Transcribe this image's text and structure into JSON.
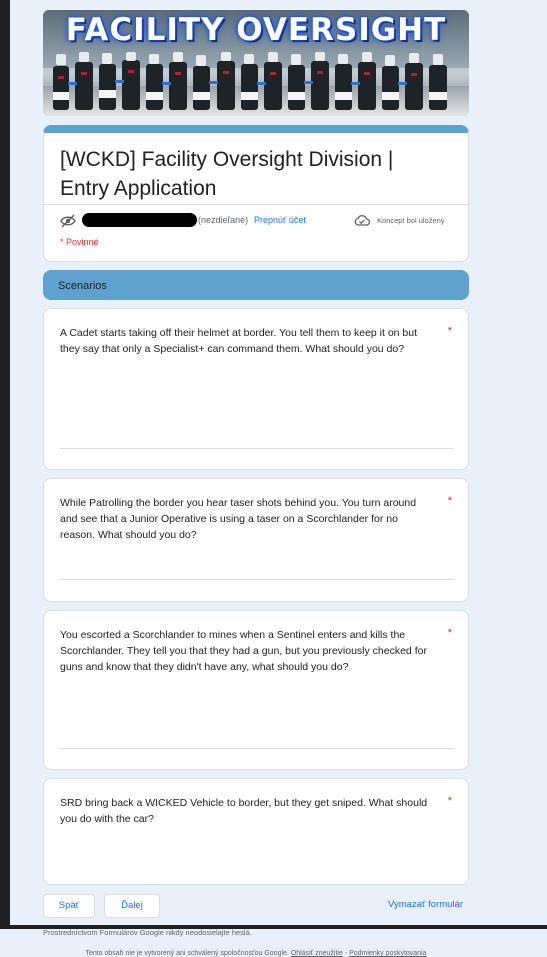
{
  "banner": {
    "title": "FACILITY OVERSIGHT"
  },
  "form": {
    "title": "[WCKD] Facility Oversight Division | Entry Application",
    "account_not_shared": "(nezdieľané)",
    "switch_account": "Prepnúť účet",
    "draft_status": "Koncept bol uložený",
    "required_note": "* Povinné"
  },
  "section": {
    "title": "Scenarios"
  },
  "questions": [
    {
      "text": "A Cadet starts taking off their helmet at border. You tell them to keep it on but they say that only a Specialist+ can command them. What should you do?",
      "required": "*"
    },
    {
      "text": "While Patrolling the border you hear taser shots behind you. You turn around and see that a Junior Operative is using a taser on a Scorchlander for no reason. What should you do?",
      "required": "*"
    },
    {
      "text": "You escorted a Scorchlander to mines when a Sentinel enters and kills the Scorchlander. They tell you that they had a gun, but you previously checked for guns and know that they didn't have any, what should you do?",
      "required": "*"
    },
    {
      "text": "SRD bring back a WICKED Vehicle to border, but they get sniped. What should you do with the car?",
      "required": "*"
    }
  ],
  "nav": {
    "back": "Späť",
    "next": "Ďalej",
    "clear": "Vymazať formulár"
  },
  "footer": {
    "never_submit": "Prostredníctvom Formulárov Google nikdy neodosielajte heslá.",
    "disclaimer": "Tento obsah nie je vytvorený ani schválený spoločnosťou Google.",
    "report_link": "Ohlásiť zneužitie",
    "separator": "-",
    "terms_link": "Podmienky poskytovania"
  },
  "icons": {
    "visibility": "visibility-off-icon",
    "cloud": "cloud-done-icon"
  },
  "colors": {
    "accent": "#5fa2d0",
    "link": "#1a73e8",
    "required": "#d93025",
    "background": "#e8f1f9"
  }
}
